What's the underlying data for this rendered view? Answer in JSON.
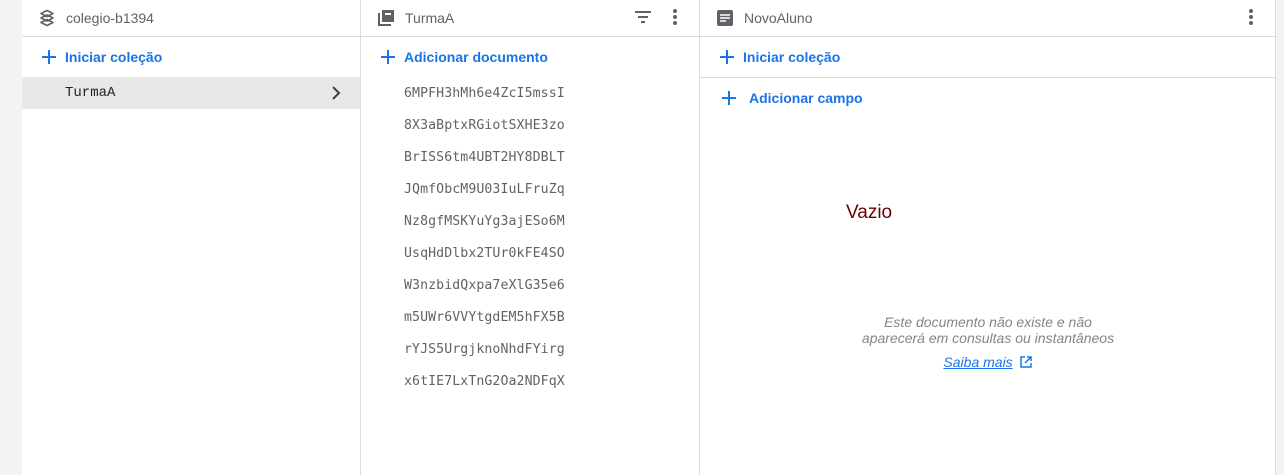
{
  "panel_root": {
    "title": "colegio-b1394",
    "icon": "firestore-layers-icon",
    "add_label": "Iniciar coleção",
    "selected_collection": "TurmaA"
  },
  "panel_collection": {
    "title": "TurmaA",
    "icon": "collection-icon",
    "add_label": "Adicionar documento",
    "documents": [
      "6MPFH3hMh6e4ZcI5mssI",
      "8X3aBptxRGiotSXHE3zo",
      "BrISS6tm4UBT2HY8DBLT",
      "JQmfObcM9U03IuLFruZq",
      "Nz8gfMSKYuYg3ajESo6M",
      "UsqHdDlbx2TUr0kFE4SO",
      "W3nzbidQxpa7eXlG35e6",
      "m5UWr6VVYtgdEM5hFX5B",
      "rYJS5UrgjknoNhdFYirg",
      "x6tIE7LxTnG2Oa2NDFqX"
    ]
  },
  "panel_document": {
    "title": "NovoAluno",
    "icon": "document-icon",
    "add_collection_label": "Iniciar coleção",
    "add_field_label": "Adicionar campo",
    "overlay_text": "Vazio",
    "empty_line1": "Este documento não existe e não",
    "empty_line2": "aparecerá em consultas ou instantâneos",
    "learn_more": "Saiba mais"
  },
  "colors": {
    "accent": "#1a73e8",
    "overlay_text": "#6d0000",
    "selected_bg": "#e8e8e8",
    "border": "#dadce0"
  }
}
